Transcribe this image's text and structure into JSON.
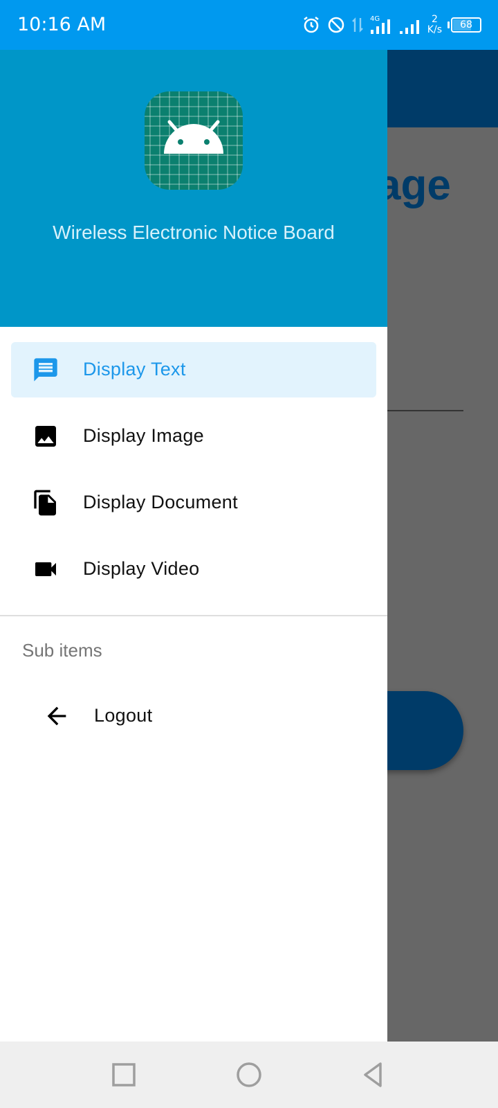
{
  "status_bar": {
    "time": "10:16 AM",
    "network_type": "4G",
    "net_speed_value": "2",
    "net_speed_unit": "K/s",
    "battery_level": "68",
    "icons": [
      "alarm-icon",
      "do-not-disturb-icon",
      "data-transfer-icon",
      "signal-4g-icon",
      "signal-icon",
      "battery-icon"
    ]
  },
  "background": {
    "title_fragment": "age"
  },
  "drawer": {
    "app_name": "Wireless Electronic Notice Board",
    "icon": "android-logo-icon",
    "items": [
      {
        "label": "Display Text",
        "icon": "message-icon",
        "selected": true
      },
      {
        "label": "Display Image",
        "icon": "image-icon",
        "selected": false
      },
      {
        "label": "Display Document",
        "icon": "document-copy-icon",
        "selected": false
      },
      {
        "label": "Display Video",
        "icon": "videocam-icon",
        "selected": false
      }
    ],
    "subheader": "Sub items",
    "logout": {
      "label": "Logout",
      "icon": "arrow-back-icon"
    }
  },
  "nav_bar": {
    "buttons": [
      "recents-icon",
      "home-icon",
      "back-icon"
    ]
  },
  "colors": {
    "status_bar": "#0099ef",
    "drawer_header": "#0096c8",
    "accent": "#1c97ea",
    "selected_bg": "#e2f3fd",
    "app_toolbar": "#003b68",
    "scrim": "#676767"
  }
}
